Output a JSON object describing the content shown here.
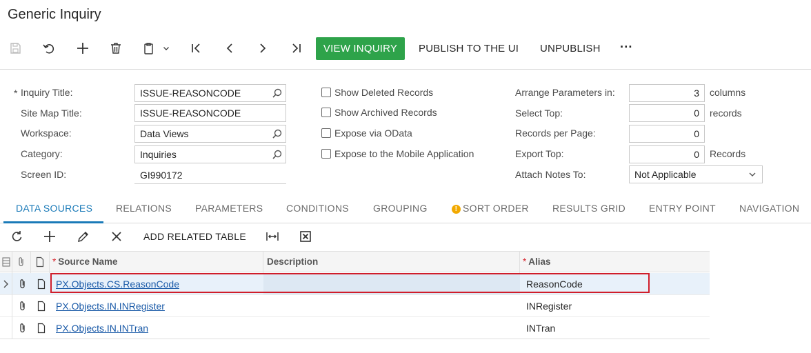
{
  "page": {
    "title": "Generic Inquiry"
  },
  "toolbar": {
    "icons": [
      "save-icon",
      "undo-icon",
      "add-icon",
      "delete-icon",
      "copy-paste-icon",
      "first-record-icon",
      "previous-record-icon",
      "next-record-icon",
      "last-record-icon"
    ],
    "view_inquiry": "VIEW INQUIRY",
    "publish": "PUBLISH TO THE UI",
    "unpublish": "UNPUBLISH",
    "more": "···",
    "accent_color": "#2ea34a"
  },
  "form": {
    "inquiry_title": {
      "label": "Inquiry Title:",
      "required_mark": "*",
      "value": "ISSUE-REASONCODE"
    },
    "site_map_title": {
      "label": "Site Map Title:",
      "value": "ISSUE-REASONCODE"
    },
    "workspace": {
      "label": "Workspace:",
      "value": "Data Views"
    },
    "category": {
      "label": "Category:",
      "value": "Inquiries"
    },
    "screen_id": {
      "label": "Screen ID:",
      "value": "GI990172"
    },
    "checkboxes": [
      {
        "label": "Show Deleted Records",
        "checked": false
      },
      {
        "label": "Show Archived Records",
        "checked": false
      },
      {
        "label": "Expose via OData",
        "checked": false
      },
      {
        "label": "Expose to the Mobile Application",
        "checked": false
      }
    ],
    "arrange_params": {
      "label": "Arrange Parameters in:",
      "value": "3",
      "suffix": "columns"
    },
    "select_top": {
      "label": "Select Top:",
      "value": "0",
      "suffix": "records"
    },
    "records_per_page": {
      "label": "Records per Page:",
      "value": "0"
    },
    "export_top": {
      "label": "Export Top:",
      "value": "0",
      "suffix": "Records"
    },
    "attach_notes": {
      "label": "Attach Notes To:",
      "value": "Not Applicable"
    }
  },
  "tabs": [
    {
      "label": "DATA SOURCES",
      "active": true
    },
    {
      "label": "RELATIONS"
    },
    {
      "label": "PARAMETERS"
    },
    {
      "label": "CONDITIONS"
    },
    {
      "label": "GROUPING"
    },
    {
      "label": "SORT ORDER",
      "warning": true,
      "warning_mark": "!"
    },
    {
      "label": "RESULTS GRID"
    },
    {
      "label": "ENTRY POINT"
    },
    {
      "label": "NAVIGATION"
    }
  ],
  "grid_toolbar": {
    "icons": [
      "refresh-icon",
      "add-row-icon",
      "edit-icon",
      "delete-row-icon",
      "fit-columns-icon",
      "export-excel-icon"
    ],
    "add_related": "ADD RELATED TABLE"
  },
  "grid": {
    "columns": [
      {
        "label": "Source Name",
        "required_mark": "*"
      },
      {
        "label": "Description"
      },
      {
        "label": "Alias",
        "required_mark": "*"
      }
    ],
    "rows": [
      {
        "source_name": "PX.Objects.CS.ReasonCode",
        "description": "",
        "alias": "ReasonCode",
        "selected": true
      },
      {
        "source_name": "PX.Objects.IN.INRegister",
        "description": "",
        "alias": "INRegister"
      },
      {
        "source_name": "PX.Objects.IN.INTran",
        "description": "",
        "alias": "INTran"
      }
    ],
    "highlight_color": "#d01d2a"
  }
}
